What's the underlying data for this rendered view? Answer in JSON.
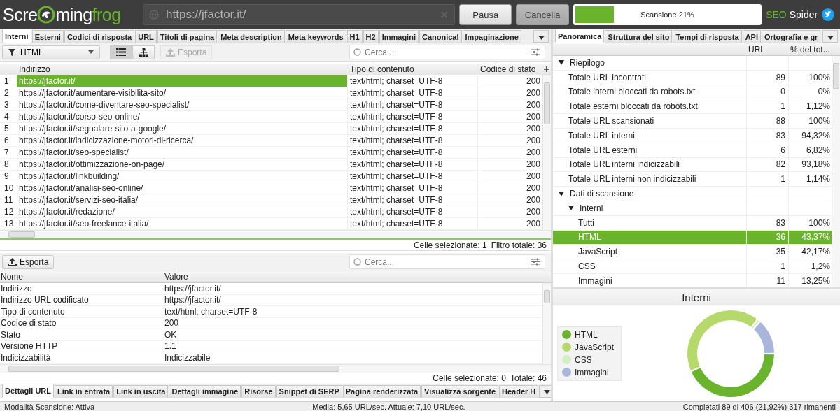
{
  "header": {
    "logo": [
      {
        "text": "Scre",
        "color": "#ffffff"
      },
      {
        "text": "ming",
        "color": "#ffffff"
      },
      {
        "text": "frog",
        "color": "#6ab42d"
      }
    ],
    "url_field": {
      "value": "https://jfactor.it/"
    },
    "buttons": [
      {
        "label": "Pausa",
        "pressed": false
      },
      {
        "label": "Cancella",
        "pressed": true
      }
    ],
    "progress": {
      "label": "Scansione 21%",
      "level": 0.21
    },
    "brand": [
      {
        "text": "SEO",
        "color": "#6ab42d"
      },
      {
        "text": "Spider",
        "color": "#ffffff"
      }
    ]
  },
  "main_tabs": [
    {
      "label": "Interni",
      "selected": true
    },
    {
      "label": "Esterni",
      "selected": false
    },
    {
      "label": "Codici di risposta",
      "selected": false
    },
    {
      "label": "URL",
      "selected": false
    },
    {
      "label": "Titoli di pagina",
      "selected": false
    },
    {
      "label": "Meta description",
      "selected": false
    },
    {
      "label": "Meta keywords",
      "selected": false
    },
    {
      "label": "H1",
      "selected": false
    },
    {
      "label": "H2",
      "selected": false
    },
    {
      "label": "Immagini",
      "selected": false
    },
    {
      "label": "Canonical",
      "selected": false
    },
    {
      "label": "Impaginazione",
      "selected": false
    }
  ],
  "main_toolbar": {
    "filter": "HTML",
    "views": [
      {
        "kind": "list",
        "selected": true
      },
      {
        "kind": "tree",
        "selected": false
      }
    ],
    "export": {
      "label": "Esporta",
      "disabled": true
    },
    "search": {
      "placeholder": "Cerca..."
    }
  },
  "main_table": {
    "columns": [
      "Indirizzo",
      "Tipo di contenuto",
      "Codice di stato"
    ],
    "rows": [
      {
        "number": "1",
        "address": "https://jfactor.it/",
        "type": "text/html; charset=UTF-8",
        "status": "200",
        "selected": true
      },
      {
        "number": "2",
        "address": "https://jfactor.it/aumentare-visibilita-sito/",
        "type": "text/html; charset=UTF-8",
        "status": "200",
        "selected": false
      },
      {
        "number": "3",
        "address": "https://jfactor.it/come-diventare-seo-specialist/",
        "type": "text/html; charset=UTF-8",
        "status": "200",
        "selected": false
      },
      {
        "number": "4",
        "address": "https://jfactor.it/corso-seo-online/",
        "type": "text/html; charset=UTF-8",
        "status": "200",
        "selected": false
      },
      {
        "number": "5",
        "address": "https://jfactor.it/segnalare-sito-a-google/",
        "type": "text/html; charset=UTF-8",
        "status": "200",
        "selected": false
      },
      {
        "number": "6",
        "address": "https://jfactor.it/indicizzazione-motori-di-ricerca/",
        "type": "text/html; charset=UTF-8",
        "status": "200",
        "selected": false
      },
      {
        "number": "7",
        "address": "https://jfactor.it/seo-specialist/",
        "type": "text/html; charset=UTF-8",
        "status": "200",
        "selected": false
      },
      {
        "number": "8",
        "address": "https://jfactor.it/ottimizzazione-on-page/",
        "type": "text/html; charset=UTF-8",
        "status": "200",
        "selected": false
      },
      {
        "number": "9",
        "address": "https://jfactor.it/linkbuilding/",
        "type": "text/html; charset=UTF-8",
        "status": "200",
        "selected": false
      },
      {
        "number": "10",
        "address": "https://jfactor.it/analisi-seo-online/",
        "type": "text/html; charset=UTF-8",
        "status": "200",
        "selected": false
      },
      {
        "number": "11",
        "address": "https://jfactor.it/servizi-seo-italia/",
        "type": "text/html; charset=UTF-8",
        "status": "200",
        "selected": false
      },
      {
        "number": "12",
        "address": "https://jfactor.it/redazione/",
        "type": "text/html; charset=UTF-8",
        "status": "200",
        "selected": false
      },
      {
        "number": "13",
        "address": "https://jfactor.it/seo-freelance-italia/",
        "type": "text/html; charset=UTF-8",
        "status": "200",
        "selected": false
      }
    ]
  },
  "main_status": [
    "Celle selezionate:  1",
    "Filtro totale:  36"
  ],
  "detail_toolbar": {
    "export": {
      "label": "Esporta",
      "disabled": false
    },
    "search": {
      "placeholder": "Cerca..."
    }
  },
  "detail_table": {
    "columns": [
      "Nome",
      "Valore"
    ],
    "rows": [
      {
        "name": "Indirizzo",
        "value": "https://jfactor.it/"
      },
      {
        "name": "Indirizzo URL codificato",
        "value": "https://jfactor.it/"
      },
      {
        "name": "Tipo di contenuto",
        "value": "text/html; charset=UTF-8"
      },
      {
        "name": "Codice di stato",
        "value": "200"
      },
      {
        "name": "Stato",
        "value": "OK"
      },
      {
        "name": "Versione HTTP",
        "value": "1.1"
      },
      {
        "name": "Indicizzabilità",
        "value": "Indicizzabile"
      }
    ]
  },
  "detail_status": [
    "Celle selezionate:  0",
    "Totale:  46"
  ],
  "bottom_tabs": [
    {
      "label": "Dettagli URL",
      "selected": true
    },
    {
      "label": "Link in entrata",
      "selected": false
    },
    {
      "label": "Link in uscita",
      "selected": false
    },
    {
      "label": "Dettagli immagine",
      "selected": false
    },
    {
      "label": "Risorse",
      "selected": false
    },
    {
      "label": "Snippet di SERP",
      "selected": false
    },
    {
      "label": "Pagina renderizzata",
      "selected": false
    },
    {
      "label": "Visualizza sorgente",
      "selected": false
    },
    {
      "label": "Header H",
      "selected": false
    }
  ],
  "right_tabs": [
    {
      "label": "Panoramica",
      "selected": true
    },
    {
      "label": "Struttura del sito",
      "selected": false
    },
    {
      "label": "Tempi di risposta",
      "selected": false
    },
    {
      "label": "API",
      "selected": false
    },
    {
      "label": "Ortografia e gr",
      "selected": false
    }
  ],
  "overview": {
    "columns": [
      "URL",
      "% del tot..."
    ],
    "rows": [
      {
        "label": "Riepilogo",
        "expanded": true,
        "selected": false,
        "children": [
          {
            "label": "Totale URL incontrati",
            "url": "89",
            "percent": "100%",
            "selected": false
          },
          {
            "label": "Totale interni bloccati da robots.txt",
            "url": "0",
            "percent": "0%",
            "selected": false
          },
          {
            "label": "Totale esterni bloccati da robots.txt",
            "url": "1",
            "percent": "1,12%",
            "selected": false
          },
          {
            "label": "Totale URL scansionati",
            "url": "88",
            "percent": "100%",
            "selected": false
          },
          {
            "label": "Totale URL interni",
            "url": "83",
            "percent": "94,32%",
            "selected": false
          },
          {
            "label": "Totale URL esterni",
            "url": "6",
            "percent": "6,82%",
            "selected": false
          },
          {
            "label": "Totale URL interni indicizzabili",
            "url": "82",
            "percent": "93,18%",
            "selected": false
          },
          {
            "label": "Totale URL interni non indicizzabili",
            "url": "1",
            "percent": "1,14%",
            "selected": false
          }
        ]
      },
      {
        "label": "Dati di scansione",
        "expanded": true,
        "selected": false,
        "children": [
          {
            "label": "Interni",
            "expanded": true,
            "selected": false,
            "children": [
              {
                "label": "Tutti",
                "url": "83",
                "percent": "100%",
                "selected": false
              },
              {
                "label": "HTML",
                "url": "36",
                "percent": "43,37%",
                "selected": true
              },
              {
                "label": "JavaScript",
                "url": "35",
                "percent": "42,17%",
                "selected": false
              },
              {
                "label": "CSS",
                "url": "1",
                "percent": "1,2%",
                "selected": false
              },
              {
                "label": "Immagini",
                "url": "11",
                "percent": "13,25%",
                "selected": false
              }
            ]
          }
        ]
      }
    ]
  },
  "chart": {
    "title": "Interni",
    "slice_colors": [
      {
        "color": "#6ab42d"
      },
      {
        "color": "#b5d96a"
      },
      {
        "color": "#d4efc0"
      },
      {
        "color": "#a9b6dc"
      }
    ],
    "chart_data": {
      "type": "donut",
      "legend": "left",
      "categories": [
        "HTML",
        "JavaScript",
        "CSS",
        "Immagini"
      ],
      "values": [
        43.37,
        42.17,
        1.2,
        13.25
      ]
    }
  },
  "status_bar": [
    "Modalità Scansione: Attiva",
    "Media: 5,65 URL/sec. Attuale: 7,10 URL/sec.",
    "Completati 89 di 406 (21,92%) 317 rimanenti"
  ]
}
